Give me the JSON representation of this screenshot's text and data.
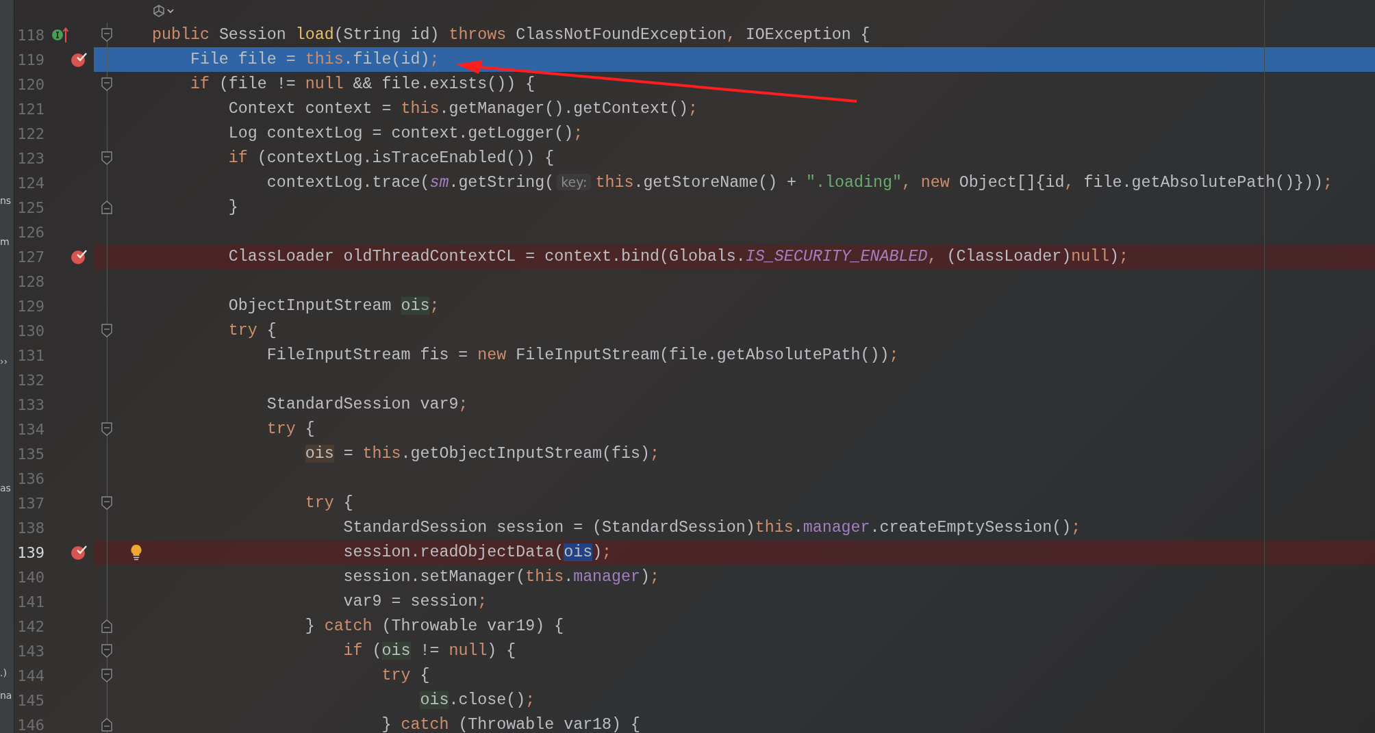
{
  "side_panel": {
    "fragments": [
      "ns",
      "m",
      "››",
      "as",
      ".)",
      "na"
    ]
  },
  "editor": {
    "lines": [
      {
        "number": "118",
        "breakpoint": false,
        "current": false,
        "caret": false,
        "fold_start": true,
        "fold_end": false,
        "implements": true,
        "bulb": false,
        "tokens": [
          {
            "kind": "keyword",
            "text": "public"
          },
          {
            "kind": "plain",
            "text": " Session "
          },
          {
            "kind": "method",
            "text": "load"
          },
          {
            "kind": "plain",
            "text": "(String id) "
          },
          {
            "kind": "keyword",
            "text": "throws"
          },
          {
            "kind": "plain",
            "text": " ClassNotFoundException"
          },
          {
            "kind": "punct",
            "text": ","
          },
          {
            "kind": "plain",
            "text": " IOException {"
          }
        ]
      },
      {
        "number": "119",
        "breakpoint": true,
        "current": true,
        "caret": false,
        "fold_start": false,
        "fold_end": false,
        "implements": false,
        "bulb": false,
        "tokens": [
          {
            "kind": "plain",
            "text": "    File file = "
          },
          {
            "kind": "keyword",
            "text": "this"
          },
          {
            "kind": "plain",
            "text": ".file(id)"
          },
          {
            "kind": "punct",
            "text": ";"
          }
        ]
      },
      {
        "number": "120",
        "breakpoint": false,
        "current": false,
        "caret": false,
        "fold_start": true,
        "fold_end": false,
        "implements": false,
        "bulb": false,
        "tokens": [
          {
            "kind": "keyword",
            "text": "    if"
          },
          {
            "kind": "plain",
            "text": " (file != "
          },
          {
            "kind": "keyword",
            "text": "null"
          },
          {
            "kind": "plain",
            "text": " && file.exists()) {"
          }
        ]
      },
      {
        "number": "121",
        "breakpoint": false,
        "current": false,
        "caret": false,
        "fold_start": false,
        "fold_end": false,
        "implements": false,
        "bulb": false,
        "tokens": [
          {
            "kind": "plain",
            "text": "        Context context = "
          },
          {
            "kind": "keyword",
            "text": "this"
          },
          {
            "kind": "plain",
            "text": ".getManager().getContext()"
          },
          {
            "kind": "punct",
            "text": ";"
          }
        ]
      },
      {
        "number": "122",
        "breakpoint": false,
        "current": false,
        "caret": false,
        "fold_start": false,
        "fold_end": false,
        "implements": false,
        "bulb": false,
        "tokens": [
          {
            "kind": "plain",
            "text": "        Log contextLog = context.getLogger()"
          },
          {
            "kind": "punct",
            "text": ";"
          }
        ]
      },
      {
        "number": "123",
        "breakpoint": false,
        "current": false,
        "caret": false,
        "fold_start": true,
        "fold_end": false,
        "implements": false,
        "bulb": false,
        "tokens": [
          {
            "kind": "keyword",
            "text": "        if"
          },
          {
            "kind": "plain",
            "text": " (contextLog.isTraceEnabled()) {"
          }
        ]
      },
      {
        "number": "124",
        "breakpoint": false,
        "current": false,
        "caret": false,
        "fold_start": false,
        "fold_end": false,
        "implements": false,
        "bulb": false,
        "tokens": [
          {
            "kind": "plain",
            "text": "            contextLog.trace("
          },
          {
            "kind": "static",
            "text": "sm"
          },
          {
            "kind": "plain",
            "text": ".getString("
          },
          {
            "kind": "hint",
            "text": "key:"
          },
          {
            "kind": "keyword",
            "text": "this"
          },
          {
            "kind": "plain",
            "text": ".getStoreName() + "
          },
          {
            "kind": "string",
            "text": "\".loading\""
          },
          {
            "kind": "punct",
            "text": ","
          },
          {
            "kind": "keyword",
            "text": " new"
          },
          {
            "kind": "plain",
            "text": " Object[]{id"
          },
          {
            "kind": "punct",
            "text": ","
          },
          {
            "kind": "plain",
            "text": " file.getAbsolutePath()}))"
          },
          {
            "kind": "punct",
            "text": ";"
          }
        ]
      },
      {
        "number": "125",
        "breakpoint": false,
        "current": false,
        "caret": false,
        "fold_start": false,
        "fold_end": true,
        "implements": false,
        "bulb": false,
        "tokens": [
          {
            "kind": "plain",
            "text": "        }"
          }
        ]
      },
      {
        "number": "126",
        "breakpoint": false,
        "current": false,
        "caret": false,
        "fold_start": false,
        "fold_end": false,
        "implements": false,
        "bulb": false
      },
      {
        "number": "127",
        "breakpoint": true,
        "current": false,
        "caret": false,
        "fold_start": false,
        "fold_end": false,
        "implements": false,
        "bulb": false,
        "tokens": [
          {
            "kind": "plain",
            "text": "        ClassLoader oldThreadContextCL = context.bind(Globals."
          },
          {
            "kind": "static",
            "text": "IS_SECURITY_ENABLED"
          },
          {
            "kind": "punct",
            "text": ","
          },
          {
            "kind": "plain",
            "text": " (ClassLoader)"
          },
          {
            "kind": "keyword",
            "text": "null"
          },
          {
            "kind": "plain",
            "text": ")"
          },
          {
            "kind": "punct",
            "text": ";"
          }
        ]
      },
      {
        "number": "128",
        "breakpoint": false,
        "current": false,
        "caret": false,
        "fold_start": false,
        "fold_end": false,
        "implements": false,
        "bulb": false
      },
      {
        "number": "129",
        "breakpoint": false,
        "current": false,
        "caret": false,
        "fold_start": false,
        "fold_end": false,
        "implements": false,
        "bulb": false,
        "tokens": [
          {
            "kind": "plain",
            "text": "        ObjectInputStream "
          },
          {
            "kind": "var_read",
            "text": "ois"
          },
          {
            "kind": "punct",
            "text": ";"
          }
        ]
      },
      {
        "number": "130",
        "breakpoint": false,
        "current": false,
        "caret": false,
        "fold_start": true,
        "fold_end": false,
        "implements": false,
        "bulb": false,
        "tokens": [
          {
            "kind": "keyword",
            "text": "        try"
          },
          {
            "kind": "plain",
            "text": " {"
          }
        ]
      },
      {
        "number": "131",
        "breakpoint": false,
        "current": false,
        "caret": false,
        "fold_start": false,
        "fold_end": false,
        "implements": false,
        "bulb": false,
        "tokens": [
          {
            "kind": "plain",
            "text": "            FileInputStream fis = "
          },
          {
            "kind": "keyword",
            "text": "new"
          },
          {
            "kind": "plain",
            "text": " FileInputStream(file.getAbsolutePath())"
          },
          {
            "kind": "punct",
            "text": ";"
          }
        ]
      },
      {
        "number": "132",
        "breakpoint": false,
        "current": false,
        "caret": false,
        "fold_start": false,
        "fold_end": false,
        "implements": false,
        "bulb": false
      },
      {
        "number": "133",
        "breakpoint": false,
        "current": false,
        "caret": false,
        "fold_start": false,
        "fold_end": false,
        "implements": false,
        "bulb": false,
        "tokens": [
          {
            "kind": "plain",
            "text": "            StandardSession var9"
          },
          {
            "kind": "punct",
            "text": ";"
          }
        ]
      },
      {
        "number": "134",
        "breakpoint": false,
        "current": false,
        "caret": false,
        "fold_start": true,
        "fold_end": false,
        "implements": false,
        "bulb": false,
        "tokens": [
          {
            "kind": "keyword",
            "text": "            try"
          },
          {
            "kind": "plain",
            "text": " {"
          }
        ]
      },
      {
        "number": "135",
        "breakpoint": false,
        "current": false,
        "caret": false,
        "fold_start": false,
        "fold_end": false,
        "implements": false,
        "bulb": false,
        "tokens": [
          {
            "kind": "var_write",
            "text": "                ois"
          },
          {
            "kind": "plain",
            "text": " = "
          },
          {
            "kind": "keyword",
            "text": "this"
          },
          {
            "kind": "plain",
            "text": ".getObjectInputStream(fis)"
          },
          {
            "kind": "punct",
            "text": ";"
          }
        ]
      },
      {
        "number": "136",
        "breakpoint": false,
        "current": false,
        "caret": false,
        "fold_start": false,
        "fold_end": false,
        "implements": false,
        "bulb": false
      },
      {
        "number": "137",
        "breakpoint": false,
        "current": false,
        "caret": false,
        "fold_start": true,
        "fold_end": false,
        "implements": false,
        "bulb": false,
        "tokens": [
          {
            "kind": "keyword",
            "text": "                try"
          },
          {
            "kind": "plain",
            "text": " {"
          }
        ]
      },
      {
        "number": "138",
        "breakpoint": false,
        "current": false,
        "caret": false,
        "fold_start": false,
        "fold_end": false,
        "implements": false,
        "bulb": false,
        "tokens": [
          {
            "kind": "plain",
            "text": "                    StandardSession session = (StandardSession)"
          },
          {
            "kind": "keyword",
            "text": "this"
          },
          {
            "kind": "plain",
            "text": "."
          },
          {
            "kind": "field",
            "text": "manager"
          },
          {
            "kind": "plain",
            "text": ".createEmptySession()"
          },
          {
            "kind": "punct",
            "text": ";"
          }
        ]
      },
      {
        "number": "139",
        "breakpoint": true,
        "current": false,
        "caret": true,
        "fold_start": false,
        "fold_end": false,
        "implements": false,
        "bulb": true,
        "tokens": [
          {
            "kind": "plain",
            "text": "                    session.readObjectData("
          },
          {
            "kind": "var_caret",
            "text": "ois"
          },
          {
            "kind": "plain",
            "text": ")"
          },
          {
            "kind": "punct",
            "text": ";"
          }
        ]
      },
      {
        "number": "140",
        "breakpoint": false,
        "current": false,
        "caret": false,
        "fold_start": false,
        "fold_end": false,
        "implements": false,
        "bulb": false,
        "tokens": [
          {
            "kind": "plain",
            "text": "                    session.setManager("
          },
          {
            "kind": "keyword",
            "text": "this"
          },
          {
            "kind": "plain",
            "text": "."
          },
          {
            "kind": "field",
            "text": "manager"
          },
          {
            "kind": "plain",
            "text": ")"
          },
          {
            "kind": "punct",
            "text": ";"
          }
        ]
      },
      {
        "number": "141",
        "breakpoint": false,
        "current": false,
        "caret": false,
        "fold_start": false,
        "fold_end": false,
        "implements": false,
        "bulb": false,
        "tokens": [
          {
            "kind": "plain",
            "text": "                    var9 = session"
          },
          {
            "kind": "punct",
            "text": ";"
          }
        ]
      },
      {
        "number": "142",
        "breakpoint": false,
        "current": false,
        "caret": false,
        "fold_start": false,
        "fold_end": true,
        "implements": false,
        "bulb": false,
        "tokens": [
          {
            "kind": "plain",
            "text": "                } "
          },
          {
            "kind": "keyword",
            "text": "catch"
          },
          {
            "kind": "plain",
            "text": " (Throwable var19) {"
          }
        ]
      },
      {
        "number": "143",
        "breakpoint": false,
        "current": false,
        "caret": false,
        "fold_start": true,
        "fold_end": false,
        "implements": false,
        "bulb": false,
        "tokens": [
          {
            "kind": "keyword",
            "text": "                    if"
          },
          {
            "kind": "plain",
            "text": " ("
          },
          {
            "kind": "var_read",
            "text": "ois"
          },
          {
            "kind": "plain",
            "text": " != "
          },
          {
            "kind": "keyword",
            "text": "null"
          },
          {
            "kind": "plain",
            "text": ") {"
          }
        ]
      },
      {
        "number": "144",
        "breakpoint": false,
        "current": false,
        "caret": false,
        "fold_start": true,
        "fold_end": false,
        "implements": false,
        "bulb": false,
        "tokens": [
          {
            "kind": "keyword",
            "text": "                        try"
          },
          {
            "kind": "plain",
            "text": " {"
          }
        ]
      },
      {
        "number": "145",
        "breakpoint": false,
        "current": false,
        "caret": false,
        "fold_start": false,
        "fold_end": false,
        "implements": false,
        "bulb": false,
        "tokens": [
          {
            "kind": "var_read",
            "text": "                            ois"
          },
          {
            "kind": "plain",
            "text": ".close()"
          },
          {
            "kind": "punct",
            "text": ";"
          }
        ]
      },
      {
        "number": "146",
        "breakpoint": false,
        "current": false,
        "caret": false,
        "fold_start": false,
        "fold_end": true,
        "implements": false,
        "bulb": false,
        "tokens": [
          {
            "kind": "plain",
            "text": "                        } "
          },
          {
            "kind": "keyword",
            "text": "catch"
          },
          {
            "kind": "plain",
            "text": " (Throwable var18) {"
          }
        ]
      }
    ]
  }
}
